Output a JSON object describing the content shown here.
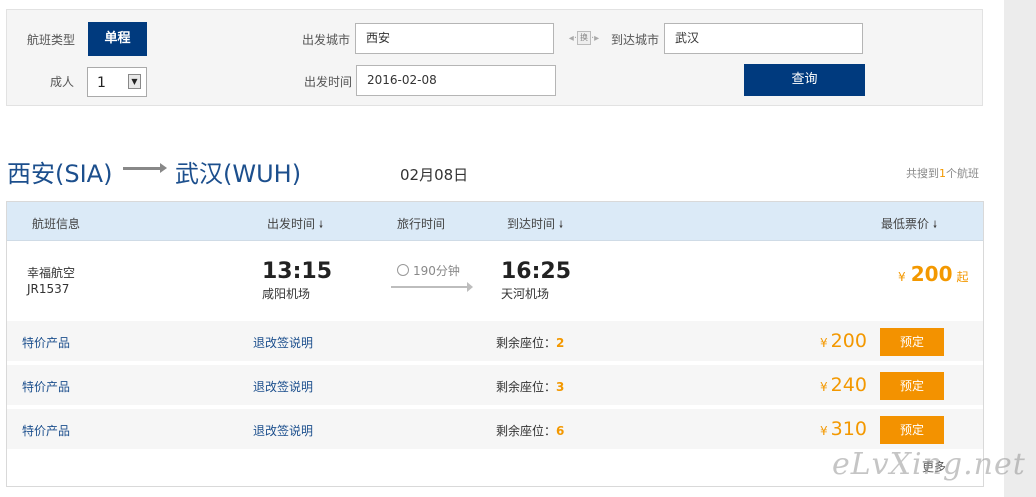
{
  "search": {
    "flight_type_label": "航班类型",
    "flight_type_value": "单程",
    "adults_label": "成人",
    "adults_value": "1",
    "from_label": "出发城市",
    "from_value": "西安",
    "swap_label": "换",
    "to_label": "到达城市",
    "to_value": "武汉",
    "date_label": "出发时间",
    "date_value": "2016-02-08",
    "query_button": "查询"
  },
  "route": {
    "from": "西安(SIA)",
    "to": "武汉(WUH)",
    "date": "02月08日",
    "found_prefix": "共搜到",
    "found_count": "1",
    "found_suffix": "个航班"
  },
  "table_headers": {
    "flight_info": "航班信息",
    "depart_time": "出发时间",
    "travel_time": "旅行时间",
    "arrive_time": "到达时间",
    "min_price": "最低票价",
    "sort_icon": "arrow-down-icon"
  },
  "flight": {
    "airline": "幸福航空",
    "flight_no": "JR1537",
    "depart_time": "13:15",
    "depart_airport": "咸阳机场",
    "duration": "190分钟",
    "arrive_time": "16:25",
    "arrive_airport": "天河机场",
    "min_price_symbol": "¥",
    "min_price": "200",
    "min_price_suffix": "起"
  },
  "products": [
    {
      "name": "特价产品",
      "rules_link": "退改签说明",
      "seats_label": "剩余座位：",
      "seats": "2",
      "symbol": "¥",
      "price": "200",
      "book": "预定"
    },
    {
      "name": "特价产品",
      "rules_link": "退改签说明",
      "seats_label": "剩余座位：",
      "seats": "3",
      "symbol": "¥",
      "price": "240",
      "book": "预定"
    },
    {
      "name": "特价产品",
      "rules_link": "退改签说明",
      "seats_label": "剩余座位：",
      "seats": "6",
      "symbol": "¥",
      "price": "310",
      "book": "预定"
    }
  ],
  "more_link": "更多",
  "watermark": "eLvXing.net",
  "colors": {
    "primary": "#003a7e",
    "accent": "#f39200",
    "header_bg": "#dbeaf7"
  }
}
